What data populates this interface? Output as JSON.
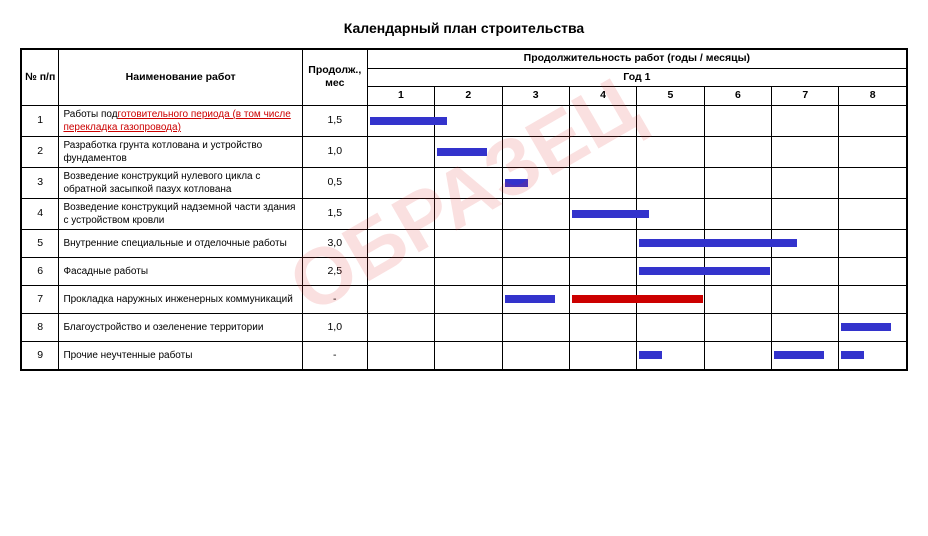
{
  "title": "Календарный план строительства",
  "watermark": "ОБРАЗЕЦ",
  "headers": {
    "num": "№ п/п",
    "name": "Наименование работ",
    "dur": "Продолж., мес",
    "duration_span": "Продолжительность работ (годы / месяцы)",
    "year1": "Год 1",
    "months": [
      "1",
      "2",
      "3",
      "4",
      "5",
      "6",
      "7",
      "8"
    ]
  },
  "rows": [
    {
      "num": "1",
      "name": "Работы подготовительного периода (в том числе перекладка газопровода)",
      "highlight": "подготовительного периода (в том числе перекладка газопровода)",
      "dur": "1,5",
      "bars": [
        {
          "col": 1,
          "width": 1.5,
          "type": "blue"
        }
      ]
    },
    {
      "num": "2",
      "name": "Разработка грунта котлована и устройство фундаментов",
      "dur": "1,0",
      "bars": [
        {
          "col": 2,
          "width": 1.0,
          "type": "blue"
        }
      ]
    },
    {
      "num": "3",
      "name": "Возведение конструкций нулевого цикла с обратной засыпкой пазух котлована",
      "dur": "0,5",
      "bars": [
        {
          "col": 3,
          "width": 0.5,
          "type": "blue"
        }
      ]
    },
    {
      "num": "4",
      "name": "Возведение конструкций надземной части здания с устройством кровли",
      "dur": "1,5",
      "bars": [
        {
          "col": 4,
          "width": 1.5,
          "type": "blue"
        }
      ]
    },
    {
      "num": "5",
      "name": "Внутренние специальные и отделочные работы",
      "dur": "3,0",
      "bars": [
        {
          "col": 5,
          "width": 3.0,
          "type": "blue"
        }
      ]
    },
    {
      "num": "6",
      "name": "Фасадные работы",
      "dur": "2,5",
      "bars": [
        {
          "col": 5,
          "width": 2.5,
          "type": "blue"
        }
      ]
    },
    {
      "num": "7",
      "name": "Прокладка наружных инженерных коммуникаций",
      "dur": "-",
      "bars": [
        {
          "col": 3,
          "width": 1.0,
          "type": "blue"
        },
        {
          "col": 4,
          "width": 2.5,
          "type": "red"
        }
      ]
    },
    {
      "num": "8",
      "name": "Благоустройство и озеленение территории",
      "dur": "1,0",
      "bars": [
        {
          "col": 8,
          "width": 1.0,
          "type": "blue"
        }
      ]
    },
    {
      "num": "9",
      "name": "Прочие неучтенные работы",
      "dur": "-",
      "bars": [
        {
          "col": 5,
          "width": 0.5,
          "type": "blue"
        },
        {
          "col": 7,
          "width": 1.0,
          "type": "blue"
        },
        {
          "col": 8,
          "width": 0.5,
          "type": "blue"
        }
      ]
    }
  ]
}
